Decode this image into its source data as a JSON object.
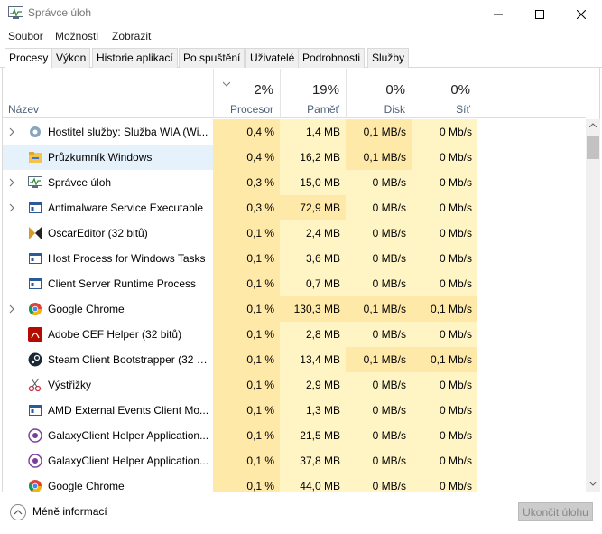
{
  "window": {
    "title": "Správce úloh"
  },
  "menu": [
    "Soubor",
    "Možnosti",
    "Zobrazit"
  ],
  "tabs": [
    "Procesy",
    "Výkon",
    "Historie aplikací",
    "Po spuštění",
    "Uživatelé",
    "Podrobnosti",
    "Služby"
  ],
  "active_tab": "Procesy",
  "columns": {
    "name": "Název",
    "cpu": {
      "pct": "2%",
      "label": "Procesor"
    },
    "mem": {
      "pct": "19%",
      "label": "Paměť"
    },
    "disk": {
      "pct": "0%",
      "label": "Disk"
    },
    "net": {
      "pct": "0%",
      "label": "Síť"
    }
  },
  "rows": [
    {
      "name": "Hostitel služby: Služba WIA (Wi...",
      "cpu": "0,4 %",
      "mem": "1,4 MB",
      "disk": "0,1 MB/s",
      "net": "0 Mb/s",
      "icon": "gear-icon",
      "expand": true
    },
    {
      "name": "Průzkumník Windows",
      "cpu": "0,4 %",
      "mem": "16,2 MB",
      "disk": "0,1 MB/s",
      "net": "0 Mb/s",
      "icon": "folder-icon",
      "expand": false,
      "selected": true
    },
    {
      "name": "Správce úloh",
      "cpu": "0,3 %",
      "mem": "15,0 MB",
      "disk": "0 MB/s",
      "net": "0 Mb/s",
      "icon": "task-manager-icon",
      "expand": true
    },
    {
      "name": "Antimalware Service Executable",
      "cpu": "0,3 %",
      "mem": "72,9 MB",
      "disk": "0 MB/s",
      "net": "0 Mb/s",
      "icon": "service-window-icon",
      "expand": true
    },
    {
      "name": "OscarEditor (32 bitů)",
      "cpu": "0,1 %",
      "mem": "2,4 MB",
      "disk": "0 MB/s",
      "net": "0 Mb/s",
      "icon": "oscar-editor-icon",
      "expand": false
    },
    {
      "name": "Host Process for Windows Tasks",
      "cpu": "0,1 %",
      "mem": "3,6 MB",
      "disk": "0 MB/s",
      "net": "0 Mb/s",
      "icon": "service-window-icon",
      "expand": false
    },
    {
      "name": "Client Server Runtime Process",
      "cpu": "0,1 %",
      "mem": "0,7 MB",
      "disk": "0 MB/s",
      "net": "0 Mb/s",
      "icon": "service-window-icon",
      "expand": false
    },
    {
      "name": "Google Chrome",
      "cpu": "0,1 %",
      "mem": "130,3 MB",
      "disk": "0,1 MB/s",
      "net": "0,1 Mb/s",
      "icon": "chrome-icon",
      "expand": true
    },
    {
      "name": "Adobe CEF Helper (32 bitů)",
      "cpu": "0,1 %",
      "mem": "2,8 MB",
      "disk": "0 MB/s",
      "net": "0 Mb/s",
      "icon": "adobe-icon",
      "expand": false
    },
    {
      "name": "Steam Client Bootstrapper (32 b...",
      "cpu": "0,1 %",
      "mem": "13,4 MB",
      "disk": "0,1 MB/s",
      "net": "0,1 Mb/s",
      "icon": "steam-icon",
      "expand": false
    },
    {
      "name": "Výstřižky",
      "cpu": "0,1 %",
      "mem": "2,9 MB",
      "disk": "0 MB/s",
      "net": "0 Mb/s",
      "icon": "scissors-icon",
      "expand": false
    },
    {
      "name": "AMD External Events Client Mo...",
      "cpu": "0,1 %",
      "mem": "1,3 MB",
      "disk": "0 MB/s",
      "net": "0 Mb/s",
      "icon": "service-window-icon",
      "expand": false
    },
    {
      "name": "GalaxyClient Helper Application...",
      "cpu": "0,1 %",
      "mem": "21,5 MB",
      "disk": "0 MB/s",
      "net": "0 Mb/s",
      "icon": "galaxy-icon",
      "expand": false
    },
    {
      "name": "GalaxyClient Helper Application...",
      "cpu": "0,1 %",
      "mem": "37,8 MB",
      "disk": "0 MB/s",
      "net": "0 Mb/s",
      "icon": "galaxy-icon",
      "expand": false
    },
    {
      "name": "Google Chrome",
      "cpu": "0,1 %",
      "mem": "44,0 MB",
      "disk": "0 MB/s",
      "net": "0 Mb/s",
      "icon": "chrome-icon",
      "expand": false
    }
  ],
  "footer": {
    "less_info": "Méně informací",
    "end_task": "Ukončit úlohu"
  }
}
